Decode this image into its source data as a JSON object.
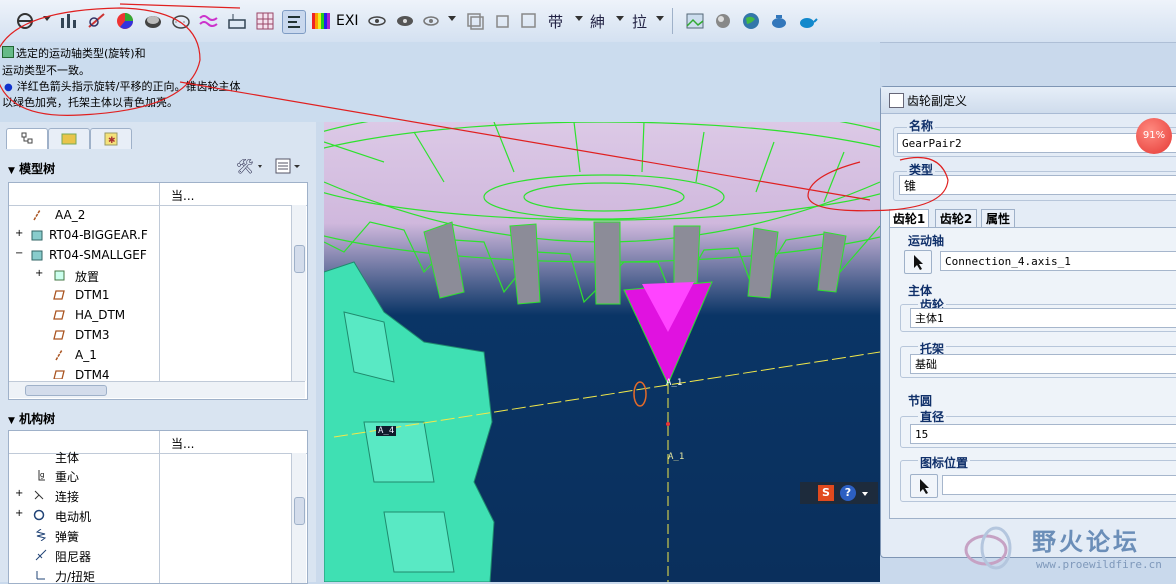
{
  "toolbar": {
    "exi_label": "EXI",
    "colors": {
      "bg_top": "#eef3fa",
      "bg_bottom": "#d4e1f1"
    }
  },
  "message": {
    "line1": "选定的运动轴类型(旋转)和",
    "line2": "运动类型不一致。",
    "line3": "洋红色箭头指示旋转/平移的正向。锥齿轮主体",
    "line4": "以绿色加亮，托架主体以青色加亮。"
  },
  "model_tree": {
    "header": "模型树",
    "column_label": "当...",
    "rows": [
      {
        "label": "AA_2",
        "icon": "axis-icon"
      },
      {
        "label": "RT04-BIGGEAR.F",
        "icon": "part-icon"
      },
      {
        "label": "RT04-SMALLGEF",
        "icon": "part-icon"
      },
      {
        "label": "放置",
        "icon": "placement-icon"
      },
      {
        "label": "DTM1",
        "icon": "datum-plane-icon"
      },
      {
        "label": "HA_DTM",
        "icon": "datum-plane-icon"
      },
      {
        "label": "DTM3",
        "icon": "datum-plane-icon"
      },
      {
        "label": "A_1",
        "icon": "axis-icon"
      },
      {
        "label": "DTM4",
        "icon": "datum-plane-icon"
      }
    ]
  },
  "mechanism_tree": {
    "header": "机构树",
    "column_label": "当...",
    "rows": [
      {
        "label": "主体",
        "icon": "body-icon"
      },
      {
        "label": "重心",
        "icon": "gravity-icon"
      },
      {
        "label": "连接",
        "icon": "connection-icon"
      },
      {
        "label": "电动机",
        "icon": "motor-icon"
      },
      {
        "label": "弹簧",
        "icon": "spring-icon"
      },
      {
        "label": "阻尼器",
        "icon": "damper-icon"
      },
      {
        "label": "力/扭矩",
        "icon": "force-icon"
      }
    ]
  },
  "viewport": {
    "label_a4": "A_4",
    "label_a1": "A_1",
    "label_a1b": "A_1"
  },
  "dialog": {
    "title": "齿轮副定义",
    "name_label": "名称",
    "name_value": "GearPair2",
    "type_label": "类型",
    "type_value": "锥",
    "tabs": [
      "齿轮1",
      "齿轮2",
      "属性"
    ],
    "motion_axis_label": "运动轴",
    "motion_axis_value": "Connection_4.axis_1",
    "body_label": "主体",
    "gear_label": "齿轮",
    "gear_value": "主体1",
    "carrier_label": "托架",
    "carrier_value": "基础",
    "pitch_circle_label": "节圆",
    "diameter_label": "直径",
    "diameter_value": "15",
    "icon_position_label": "图标位置",
    "icon_position_value": ""
  },
  "badge": {
    "value": "91%"
  },
  "watermark": {
    "title": "野火论坛",
    "url": "www.proewildfire.cn"
  }
}
